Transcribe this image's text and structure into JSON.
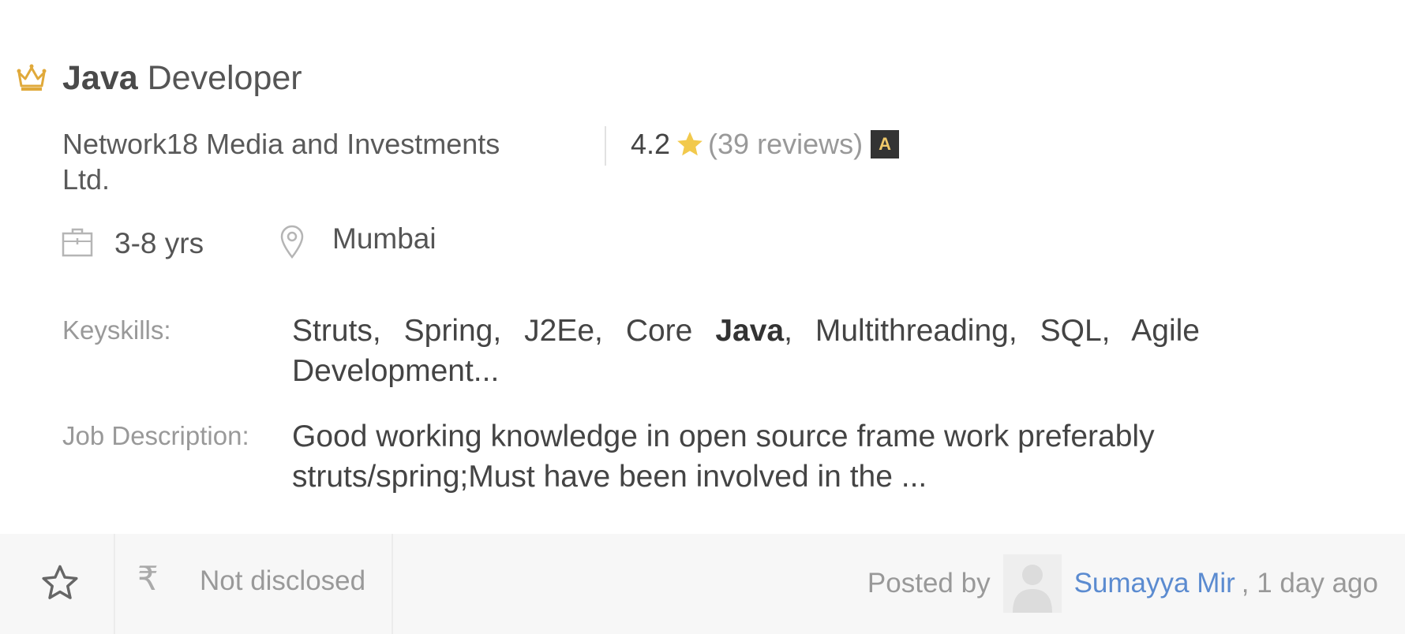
{
  "job": {
    "title_keyword": "Java",
    "title_rest": " Developer",
    "company": "Network18 Media and Investments Ltd.",
    "rating": "4.2",
    "reviews": "(39 reviews)",
    "badge": "A",
    "experience": "3-8 yrs",
    "location": "Mumbai",
    "keyskills_label": "Keyskills:",
    "keyskills_before": "Struts, Spring, J2Ee, Core ",
    "keyskills_keyword": "Java",
    "keyskills_after": ", Multithreading, SQL, Agile Development...",
    "description_label": "Job Description:",
    "description": "Good working knowledge in open source frame work preferably struts/spring;Must have been involved in the ..."
  },
  "footer": {
    "rupee_symbol": "₹",
    "salary": "Not disclosed",
    "posted_by_label": "Posted by",
    "poster_name": "Sumayya Mir",
    "posted_ago": ", 1 day ago"
  },
  "icons": {
    "crown": "crown-icon",
    "star": "star-icon",
    "briefcase": "briefcase-icon",
    "location": "location-pin-icon",
    "save": "star-outline-icon",
    "rupee": "rupee-icon",
    "avatar": "user-avatar"
  },
  "colors": {
    "crown": "#e0a93a",
    "rating_star": "#f2c94c",
    "poster_link": "#5b8bd0",
    "footer_bg": "#f7f7f7"
  }
}
